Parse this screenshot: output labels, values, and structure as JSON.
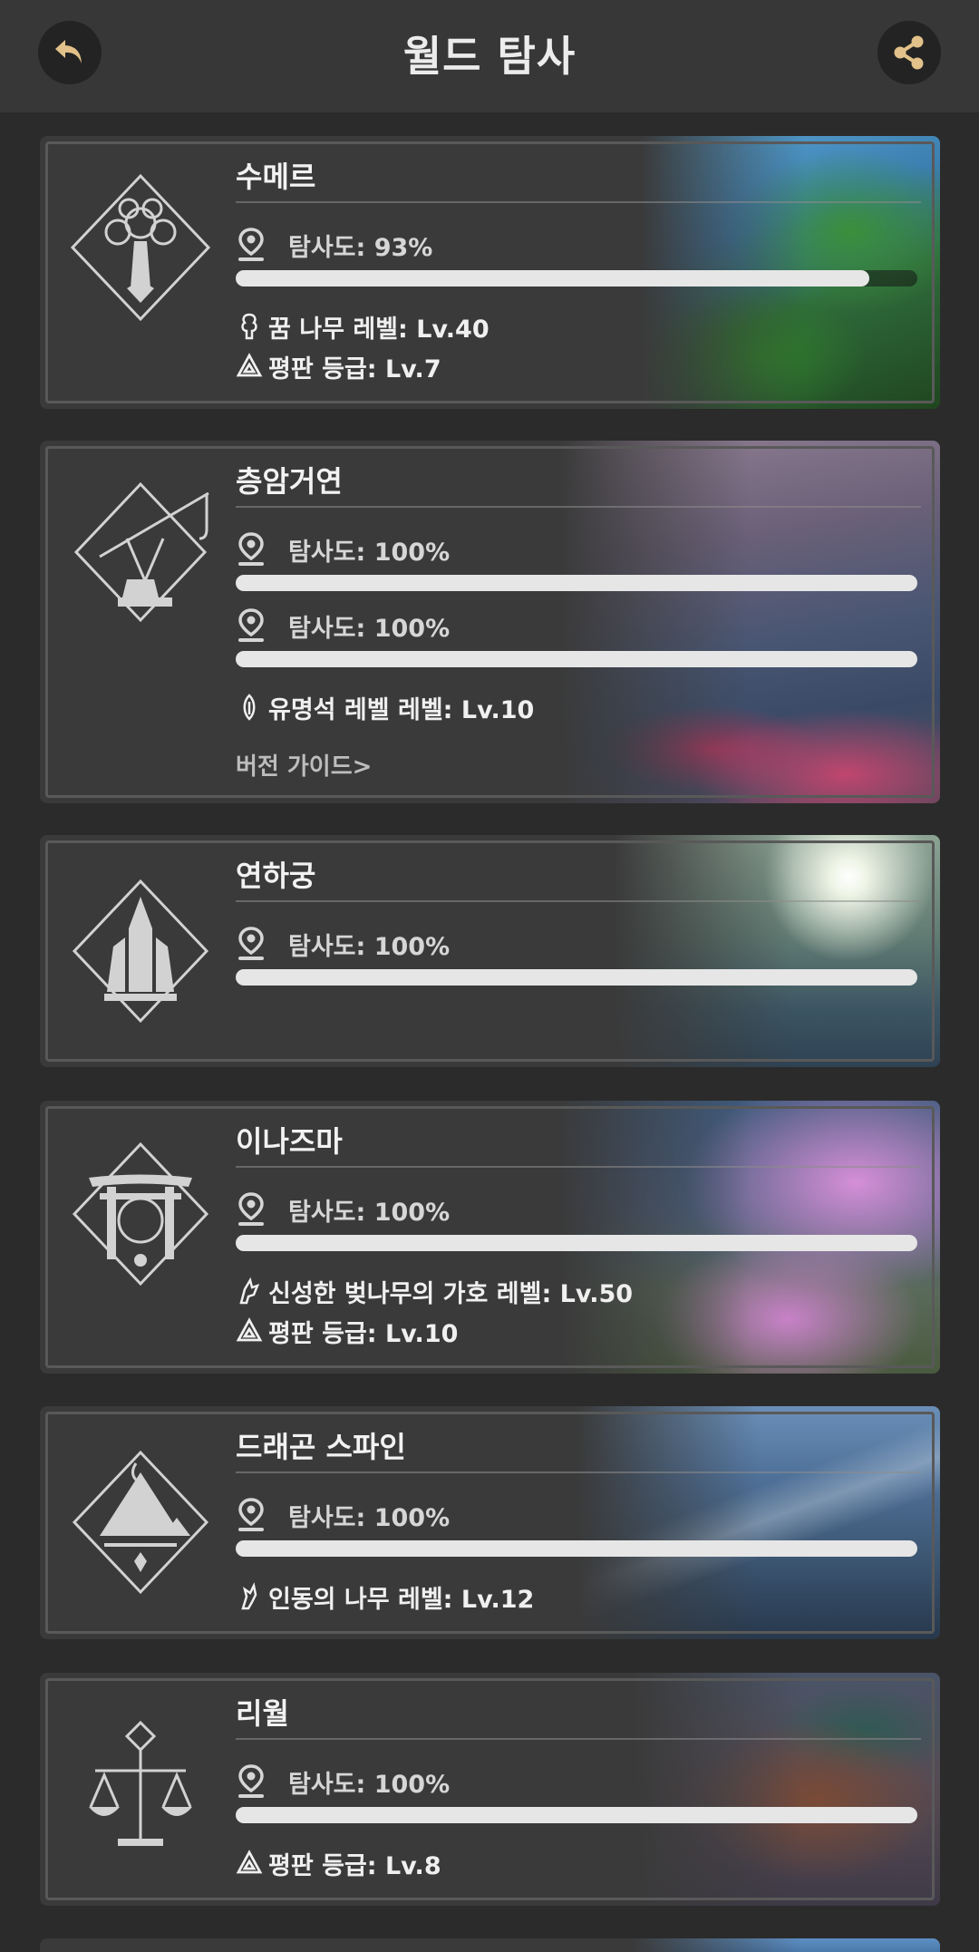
{
  "header": {
    "title": "월드 탐사",
    "back_icon": "back-arrow-icon",
    "share_icon": "share-icon"
  },
  "colors": {
    "accent": "#e2c28a",
    "bar_fill": "#e6e6e6",
    "card_bg": "#3a3a3a"
  },
  "regions": [
    {
      "name": "수메르",
      "emblem_icon": "sumeru-tree-emblem-icon",
      "exploration": [
        {
          "label": "탐사도: 93%",
          "value": 0.93
        }
      ],
      "stats": [
        {
          "icon": "dream-tree-icon",
          "text": "꿈 나무 레벨: Lv.40"
        },
        {
          "icon": "reputation-icon",
          "text": "평판 등급: Lv.7"
        }
      ]
    },
    {
      "name": "층암거연",
      "emblem_icon": "chasm-crane-emblem-icon",
      "exploration": [
        {
          "label": "탐사도: 100%",
          "value": 1.0
        },
        {
          "label": "탐사도: 100%",
          "value": 1.0
        }
      ],
      "stats": [
        {
          "icon": "lumenstone-icon",
          "text": "유명석 레벨 레벨: Lv.10"
        }
      ],
      "guide": "버전 가이드>"
    },
    {
      "name": "연하궁",
      "emblem_icon": "enkanomiya-emblem-icon",
      "exploration": [
        {
          "label": "탐사도: 100%",
          "value": 1.0
        }
      ],
      "stats": []
    },
    {
      "name": "이나즈마",
      "emblem_icon": "inazuma-torii-emblem-icon",
      "exploration": [
        {
          "label": "탐사도: 100%",
          "value": 1.0
        }
      ],
      "stats": [
        {
          "icon": "sacred-sakura-icon",
          "text": "신성한 벚나무의 가호 레벨: Lv.50"
        },
        {
          "icon": "reputation-icon",
          "text": "평판 등급: Lv.10"
        }
      ]
    },
    {
      "name": "드래곤 스파인",
      "emblem_icon": "dragonspine-emblem-icon",
      "exploration": [
        {
          "label": "탐사도: 100%",
          "value": 1.0
        }
      ],
      "stats": [
        {
          "icon": "frostbearing-tree-icon",
          "text": "인동의 나무 레벨: Lv.12"
        }
      ]
    },
    {
      "name": "리월",
      "emblem_icon": "liyue-scales-emblem-icon",
      "exploration": [
        {
          "label": "탐사도: 100%",
          "value": 1.0
        }
      ],
      "stats": [
        {
          "icon": "reputation-icon",
          "text": "평판 등급: Lv.8"
        }
      ]
    }
  ]
}
